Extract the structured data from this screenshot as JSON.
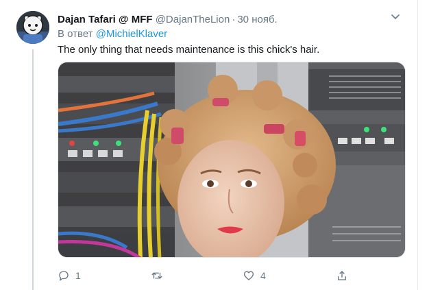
{
  "tweet": {
    "display_name": "Dajan Tafari @ MFF",
    "handle": "@DajanTheLion",
    "separator": "·",
    "date": "30 нояб.",
    "reply_prefix": "В ответ",
    "reply_to": "@MichielKlaver",
    "text": "The only thing that needs maintenance is this chick's hair."
  },
  "actions": {
    "reply_count": "1",
    "retweet_count": "",
    "like_count": "4"
  },
  "icons": {
    "reply": "reply-icon",
    "retweet": "retweet-icon",
    "like": "heart-icon",
    "share": "share-icon",
    "more": "more-icon"
  },
  "colors": {
    "link": "#1b95e0",
    "secondary_text": "#657786",
    "primary_text": "#14171a",
    "thread_line": "#ccd6dd"
  }
}
